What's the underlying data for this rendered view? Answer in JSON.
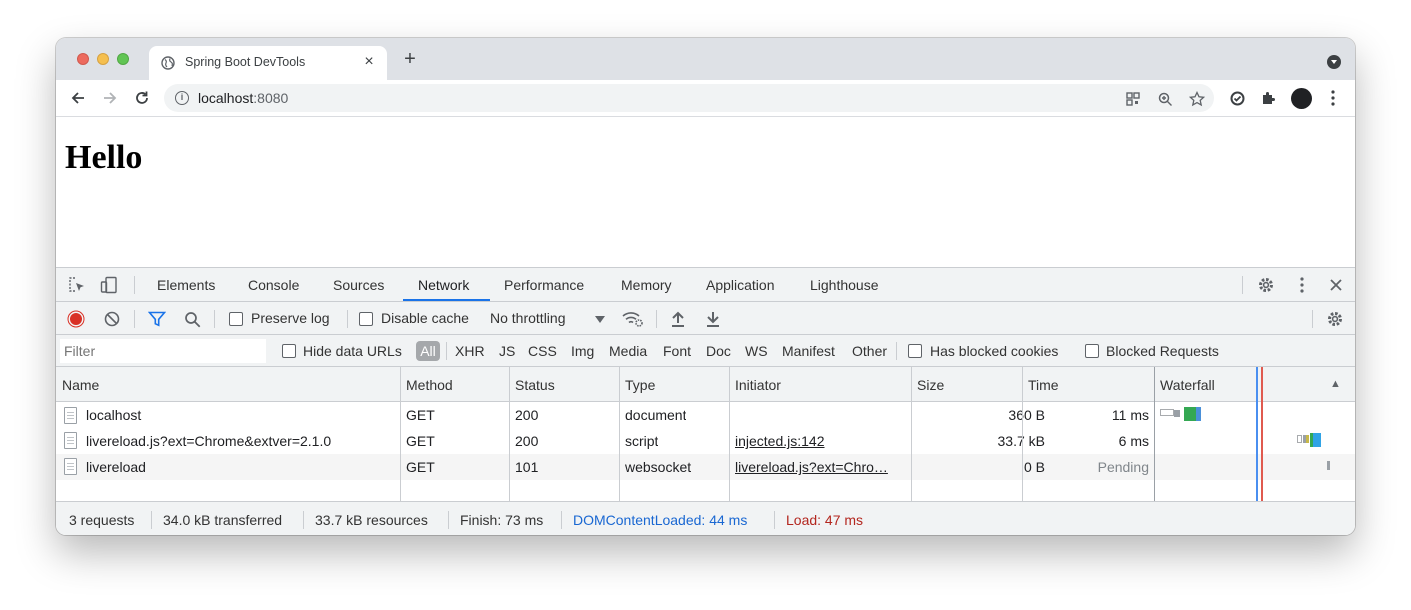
{
  "browser": {
    "tab_title": "Spring Boot DevTools",
    "tab_close": "×",
    "new_tab": "+",
    "url_host": "localhost",
    "url_port": ":8080"
  },
  "page": {
    "heading": "Hello"
  },
  "devtools": {
    "tabs": [
      {
        "label": "Elements"
      },
      {
        "label": "Console"
      },
      {
        "label": "Sources"
      },
      {
        "label": "Network",
        "active": true
      },
      {
        "label": "Performance"
      },
      {
        "label": "Memory"
      },
      {
        "label": "Application"
      },
      {
        "label": "Lighthouse"
      }
    ],
    "network_toolbar": {
      "preserve_log": "Preserve log",
      "disable_cache": "Disable cache",
      "throttling": "No throttling"
    },
    "filter_bar": {
      "filter_placeholder": "Filter",
      "hide_data_urls": "Hide data URLs",
      "all": "All",
      "types": [
        "XHR",
        "JS",
        "CSS",
        "Img",
        "Media",
        "Font",
        "Doc",
        "WS",
        "Manifest",
        "Other"
      ],
      "has_blocked_cookies": "Has blocked cookies",
      "blocked_requests": "Blocked Requests"
    },
    "table": {
      "headers": {
        "name": "Name",
        "method": "Method",
        "status": "Status",
        "type": "Type",
        "initiator": "Initiator",
        "size": "Size",
        "time": "Time",
        "waterfall": "Waterfall",
        "sort_indicator": "▲"
      },
      "rows": [
        {
          "name": "localhost",
          "method": "GET",
          "status": "200",
          "type": "document",
          "initiator": "",
          "size": "360 B",
          "time": "11 ms"
        },
        {
          "name": "livereload.js?ext=Chrome&extver=2.1.0",
          "method": "GET",
          "status": "200",
          "type": "script",
          "initiator": "injected.js:142",
          "size": "33.7 kB",
          "time": "6 ms"
        },
        {
          "name": "livereload",
          "method": "GET",
          "status": "101",
          "type": "websocket",
          "initiator": "livereload.js?ext=Chro…",
          "size": "0 B",
          "time": "Pending"
        }
      ]
    },
    "status_bar": {
      "requests": "3 requests",
      "transferred": "34.0 kB transferred",
      "resources": "33.7 kB resources",
      "finish": "Finish: 73 ms",
      "dom_content_loaded": "DOMContentLoaded: 44 ms",
      "load": "Load: 47 ms"
    },
    "colors": {
      "accent": "#1a73e8",
      "dom_content_loaded": "#1967d2",
      "load": "#b3261e",
      "record": "#d93025"
    }
  }
}
